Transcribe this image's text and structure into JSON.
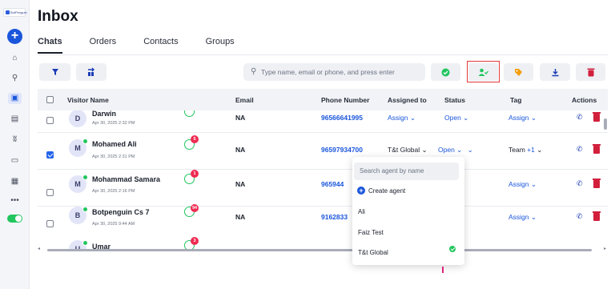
{
  "sidebar": {
    "logo_text": "BotPenguin",
    "icons": [
      "home-icon",
      "flow-icon",
      "inbox-icon",
      "reports-icon",
      "users-icon",
      "monitor-icon",
      "card-icon",
      "more-icon"
    ]
  },
  "page": {
    "title": "Inbox"
  },
  "tabs": [
    "Chats",
    "Orders",
    "Contacts",
    "Groups"
  ],
  "search": {
    "placeholder": "Type name, email or phone, and press enter"
  },
  "table": {
    "headers": [
      "Visitor Name",
      "Email",
      "Phone Number",
      "Assigned to",
      "Status",
      "Tag",
      "Actions"
    ],
    "rows": [
      {
        "initial": "D",
        "name": "Darwin",
        "date": "Apr 30, 2025 2:32 PM",
        "badge": "",
        "email": "NA",
        "phone": "96566641995",
        "assigned": "Assign",
        "status": "Open",
        "tag": "Assign",
        "checked": false
      },
      {
        "initial": "M",
        "name": "Mohamed Ali",
        "date": "Apr 30, 2025 2:31 PM",
        "badge": "5",
        "email": "NA",
        "phone": "96597934700",
        "assigned": "T&t Global",
        "status": "Open",
        "tag": "Team",
        "tag_more": "+1",
        "checked": true
      },
      {
        "initial": "M",
        "name": "Mohammad Samara",
        "date": "Apr 30, 2025 2:16 PM",
        "badge": "1",
        "email": "NA",
        "phone": "965944",
        "assigned": "",
        "status": "",
        "tag": "Assign",
        "checked": false
      },
      {
        "initial": "B",
        "name": "Botpenguin Cs 7",
        "date": "Apr 30, 2025 9:44 AM",
        "badge": "94",
        "email": "NA",
        "phone": "9162833",
        "assigned": "",
        "status": "",
        "tag": "Assign",
        "checked": false
      },
      {
        "initial": "U",
        "name": "Umar",
        "date": "",
        "badge": "3",
        "email": "",
        "phone": "",
        "assigned": "",
        "status": "",
        "tag": "",
        "checked": false
      }
    ]
  },
  "agent_dropdown": {
    "search_placeholder": "Search agent by name",
    "create_label": "Create agent",
    "agents": [
      "Ali",
      "Faiz Test",
      "T&t Global"
    ],
    "selected": "T&t Global"
  },
  "colors": {
    "primary": "#1a56db",
    "success": "#22c55e",
    "warning": "#f59e0b",
    "danger": "#d21f3c",
    "badge": "#ef2b52"
  }
}
